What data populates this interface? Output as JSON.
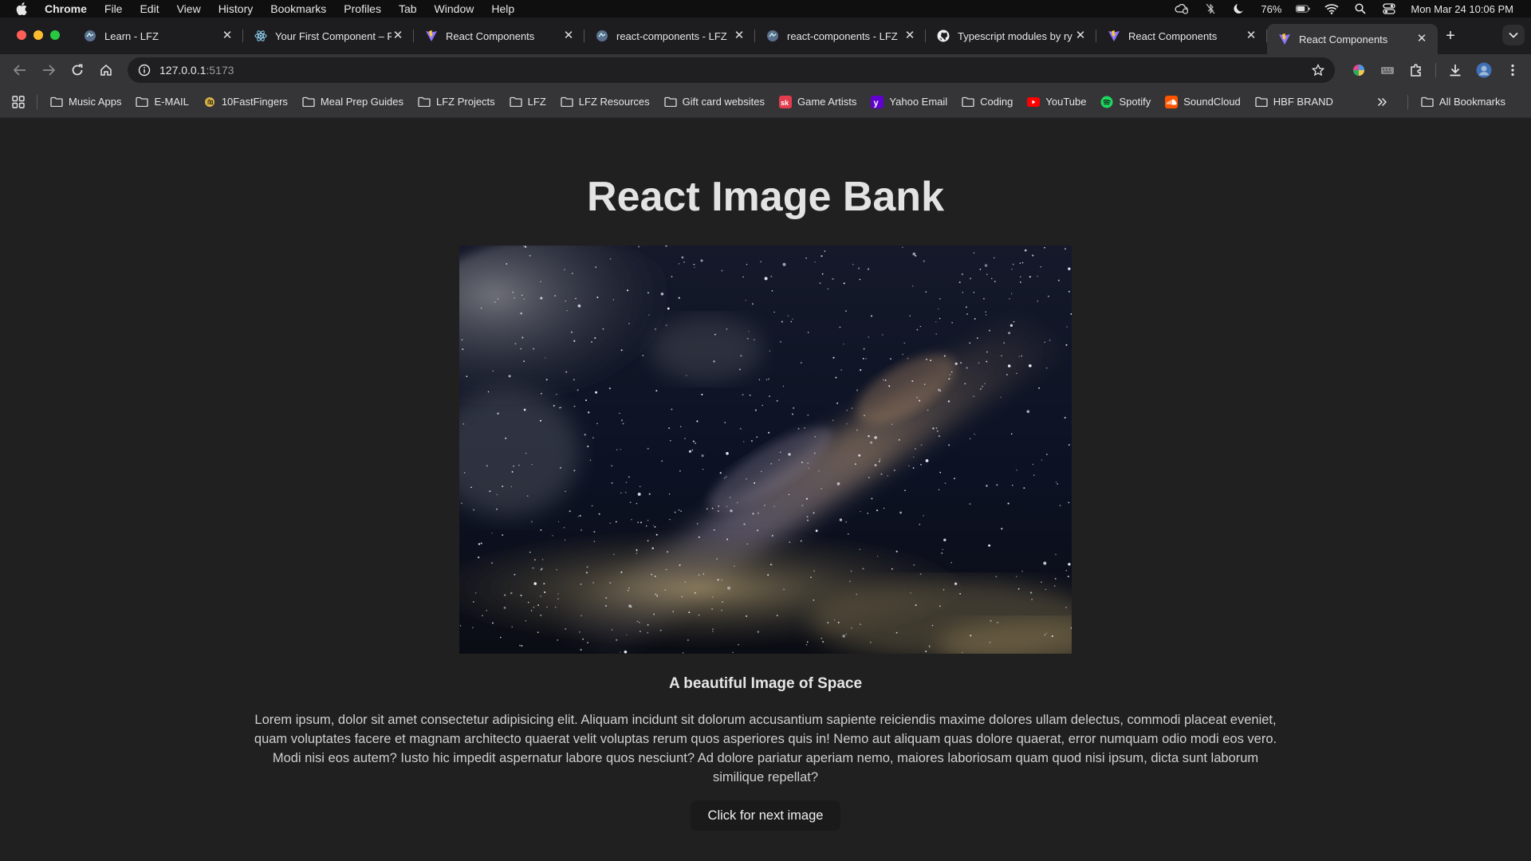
{
  "menubar": {
    "app_name": "Chrome",
    "items": [
      "File",
      "Edit",
      "View",
      "History",
      "Bookmarks",
      "Profiles",
      "Tab",
      "Window",
      "Help"
    ],
    "battery": "76%",
    "datetime": "Mon Mar 24  10:06 PM"
  },
  "tabs": [
    {
      "title": "Learn - LFZ",
      "icon": "lfz-icon"
    },
    {
      "title": "Your First Component – R",
      "icon": "react-icon"
    },
    {
      "title": "React Components",
      "icon": "vite-icon"
    },
    {
      "title": "react-components - LFZ",
      "icon": "lfz-icon"
    },
    {
      "title": "react-components - LFZ",
      "icon": "lfz-icon"
    },
    {
      "title": "Typescript modules by ry",
      "icon": "github-icon"
    },
    {
      "title": "React Components",
      "icon": "vite-icon"
    },
    {
      "title": "React Components",
      "icon": "vite-icon"
    }
  ],
  "address": {
    "host": "127.0.0.1",
    "port": ":5173"
  },
  "bookmarks": [
    {
      "label": "Music Apps",
      "icon": "folder-icon"
    },
    {
      "label": "E-MAIL",
      "icon": "folder-icon"
    },
    {
      "label": "10FastFingers",
      "icon": "tenfastfingers-icon"
    },
    {
      "label": "Meal Prep Guides",
      "icon": "folder-icon"
    },
    {
      "label": "LFZ Projects",
      "icon": "folder-icon"
    },
    {
      "label": "LFZ",
      "icon": "folder-icon"
    },
    {
      "label": "LFZ Resources",
      "icon": "folder-icon"
    },
    {
      "label": "Gift card websites",
      "icon": "folder-icon"
    },
    {
      "label": "Game Artists",
      "icon": "sk-icon"
    },
    {
      "label": "Yahoo Email",
      "icon": "yahoo-icon"
    },
    {
      "label": "Coding",
      "icon": "folder-icon"
    },
    {
      "label": "YouTube",
      "icon": "youtube-icon"
    },
    {
      "label": "Spotify",
      "icon": "spotify-icon"
    },
    {
      "label": "SoundCloud",
      "icon": "soundcloud-icon"
    },
    {
      "label": "HBF BRAND",
      "icon": "folder-icon"
    }
  ],
  "bookmarks_all": "All Bookmarks",
  "page": {
    "heading": "React Image Bank",
    "image_alt": "A beautiful Image of Space",
    "caption": "A beautiful Image of Space",
    "description": "Lorem ipsum, dolor sit amet consectetur adipisicing elit. Aliquam incidunt sit dolorum accusantium sapiente reiciendis maxime dolores ullam delectus, commodi placeat eveniet, quam voluptates facere et magnam architecto quaerat velit voluptas rerum quos asperiores quis in! Nemo aut aliquam quas dolore quaerat, error numquam odio modi eos vero. Modi nisi eos autem? Iusto hic impedit aspernatur labore quos nesciunt? Ad dolore pariatur aperiam nemo, maiores laboriosam quam quod nisi ipsum, dicta sunt laborum similique repellat?",
    "button_label": "Click for next image"
  },
  "colors": {
    "page_bg": "#202020",
    "chrome_toolbar": "#353537",
    "button_bg": "#1a1a1a"
  }
}
